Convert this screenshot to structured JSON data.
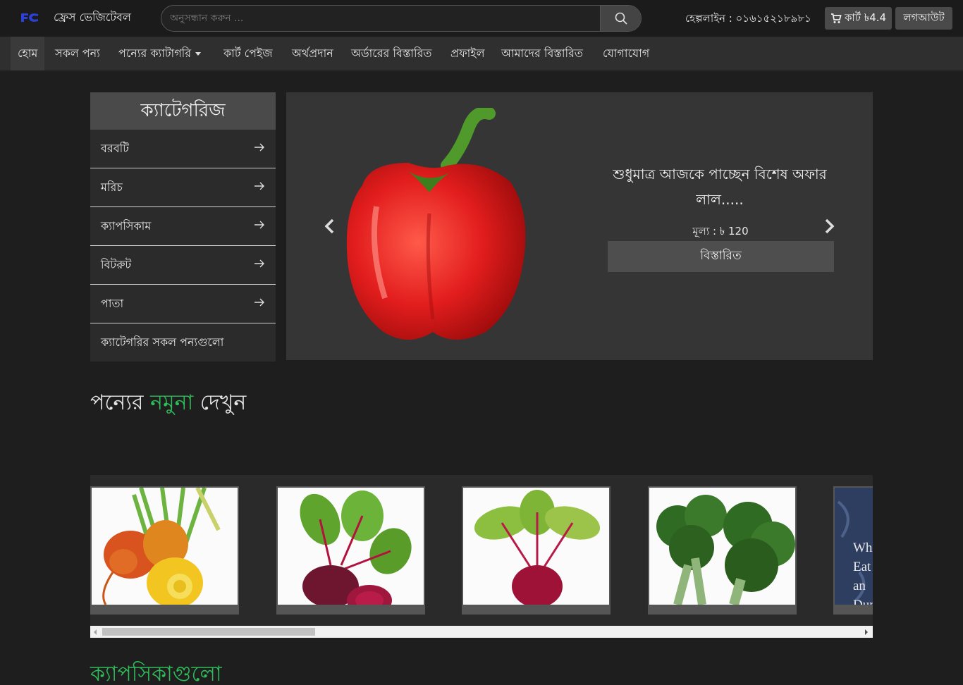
{
  "header": {
    "brand": "ফ্রেস ভেজিটেবল",
    "search_placeholder": "অনুসন্ধান করুন ...",
    "hotline": "হেল্পলাইন : ০১৬১৫২১৮৯৮১",
    "cart_label": "কার্ট ৳4.4",
    "logout_label": "লগআউট"
  },
  "nav": {
    "items": [
      {
        "label": "হোম"
      },
      {
        "label": "সকল পন্য"
      },
      {
        "label": "পন্যের ক্যাটাগরি"
      },
      {
        "label": "কার্ট পেইজ"
      },
      {
        "label": "অর্থপ্রদান"
      },
      {
        "label": "অর্ডারের বিস্তারিত"
      },
      {
        "label": "প্রফাইল"
      },
      {
        "label": "আমাদের বিস্তারিত"
      },
      {
        "label": "যোগাযোগ"
      }
    ]
  },
  "categories": {
    "title": "ক্যাটেগরিজ",
    "items": [
      {
        "label": "বরবটি"
      },
      {
        "label": "মরিচ"
      },
      {
        "label": "ক্যাপসিকাম"
      },
      {
        "label": "বিটরুট"
      },
      {
        "label": "পাতা"
      }
    ],
    "all_label": "ক্যাটেগরির সকল পন্যগুলো"
  },
  "slider": {
    "offer_text": "শুধুমাত্র আজকে পাচ্ছেন বিশেষ অফার লাল.....",
    "price": "মূল্য : ৳ 120",
    "details_label": "বিস্তারিত"
  },
  "samples": {
    "title_part1": "পন্যের ",
    "title_highlight": "নমুনা",
    "title_part2": " দেখুন",
    "fifth_card_text": "Which Eat an During"
  },
  "section2": {
    "title": "ক্যাপসিকাগুলো"
  },
  "colors": {
    "accent_green": "#2ebd59",
    "background": "#1e1e1e",
    "navbar": "#2f2f2f"
  }
}
